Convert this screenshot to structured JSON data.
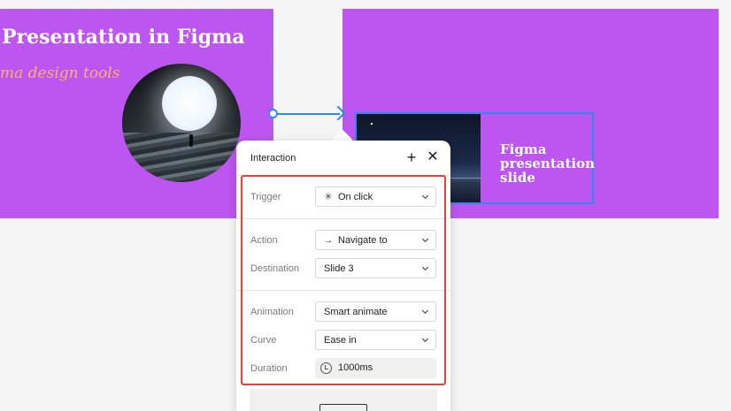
{
  "canvas": {
    "left_slide": {
      "title": "Presentation in Figma",
      "subtitle": "ma design tools"
    },
    "right_slide": {
      "caption": "Figma presentation slide"
    }
  },
  "interaction_panel": {
    "title": "Interaction",
    "add_icon": "plus-icon",
    "close_icon": "close-icon",
    "fields": {
      "trigger": {
        "label": "Trigger",
        "value": "On click",
        "icon": "tap-icon"
      },
      "action": {
        "label": "Action",
        "value": "Navigate to",
        "icon": "arrow-right-icon"
      },
      "destination": {
        "label": "Destination",
        "value": "Slide 3"
      },
      "animation": {
        "label": "Animation",
        "value": "Smart animate"
      },
      "curve": {
        "label": "Curve",
        "value": "Ease in"
      },
      "duration": {
        "label": "Duration",
        "value": "1000ms",
        "icon": "timer-icon"
      }
    }
  },
  "colors": {
    "slide_background": "#bd55f0",
    "selection_blue": "#2a8cf0",
    "highlight_red": "#e0443a"
  }
}
